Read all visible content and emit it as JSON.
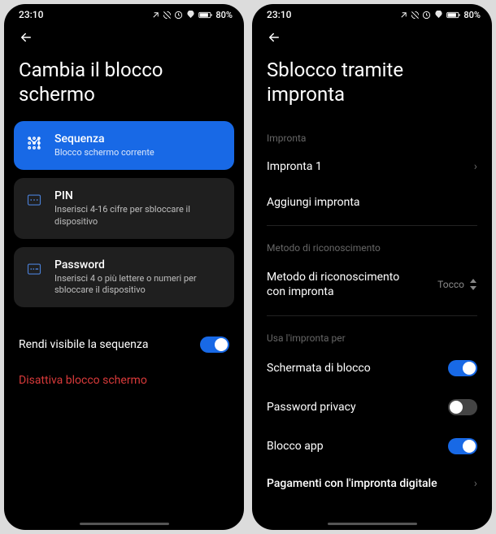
{
  "status": {
    "time": "23:10",
    "battery": "80%",
    "icons": "✱ ⌀ ⏰ ⌁ ⬤"
  },
  "left": {
    "title": "Cambia il blocco schermo",
    "options": [
      {
        "title": "Sequenza",
        "sub": "Blocco schermo corrente"
      },
      {
        "title": "PIN",
        "sub": "Inserisci 4-16 cifre per sbloccare il dispositivo"
      },
      {
        "title": "Password",
        "sub": "Inserisci 4 o più lettere o numeri per sbloccare il dispositivo"
      }
    ],
    "visible_toggle_label": "Rendi visibile la sequenza",
    "disable_label": "Disattiva blocco schermo"
  },
  "right": {
    "title": "Sblocco tramite impronta",
    "section1": "Impronta",
    "fp1": "Impronta 1",
    "add": "Aggiungi impronta",
    "section2": "Metodo di riconoscimento",
    "method_label": "Metodo di riconoscimento con impronta",
    "method_value": "Tocco",
    "section3": "Usa l'impronta per",
    "lock": "Schermata di blocco",
    "privacy": "Password privacy",
    "applock": "Blocco app",
    "payments": "Pagamenti con l'impronta digitale"
  }
}
